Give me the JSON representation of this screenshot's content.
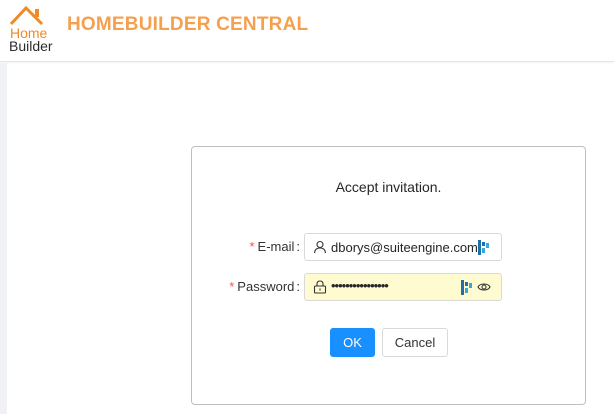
{
  "header": {
    "logo_line1": "Home",
    "logo_line2": "Builder",
    "title": "HOMEBUILDER CENTRAL"
  },
  "form": {
    "title": "Accept invitation.",
    "email_label": "E-mail",
    "email_value": "dborys@suiteengine.com",
    "password_label": "Password",
    "password_value": "••••••••••••••••",
    "required_mark": "*",
    "colon": ":",
    "ok_label": "OK",
    "cancel_label": "Cancel"
  },
  "colors": {
    "brand_orange": "#f5a04e",
    "primary_blue": "#1890ff",
    "required_red": "#ff4d4f",
    "autofill_yellow": "#fffbd0"
  },
  "icons": [
    "home-roof-logo",
    "user-icon",
    "lock-icon",
    "password-manager-icon",
    "eye-icon"
  ]
}
